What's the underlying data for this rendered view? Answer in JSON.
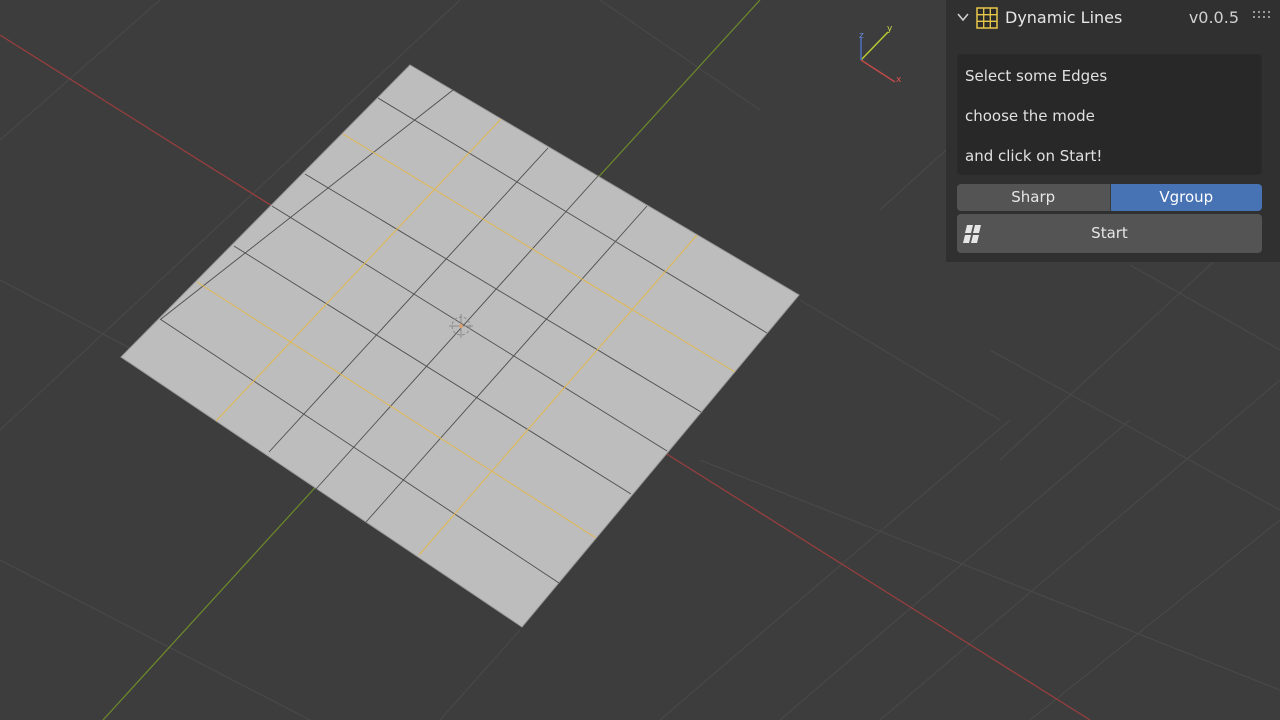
{
  "panel": {
    "title": "Dynamic Lines",
    "version": "v0.0.5",
    "info_lines": [
      "Select some Edges",
      "choose the mode",
      "and click on Start!"
    ],
    "modes": [
      {
        "label": "Sharp",
        "active": false
      },
      {
        "label": "Vgroup",
        "active": true
      }
    ],
    "start_label": "Start"
  },
  "gizmo": {
    "x_label": "x",
    "y_label": "y",
    "z_label": "z"
  },
  "colors": {
    "viewport_bg": "#3d3d3d",
    "panel_bg": "#303030",
    "active_mode": "#4772b3",
    "x_axis": "#b34a4a",
    "y_axis": "#7a9a2e",
    "plane": "#bdbdbd",
    "seam_edge": "#e2b84f",
    "addon_icon": "#e8c84a"
  },
  "icons": {
    "collapse": "chevron-down-icon",
    "addon": "grid-icon",
    "drag": "drag-handle-icon",
    "start": "mesh-faces-icon",
    "origin": "object-origin-icon"
  }
}
